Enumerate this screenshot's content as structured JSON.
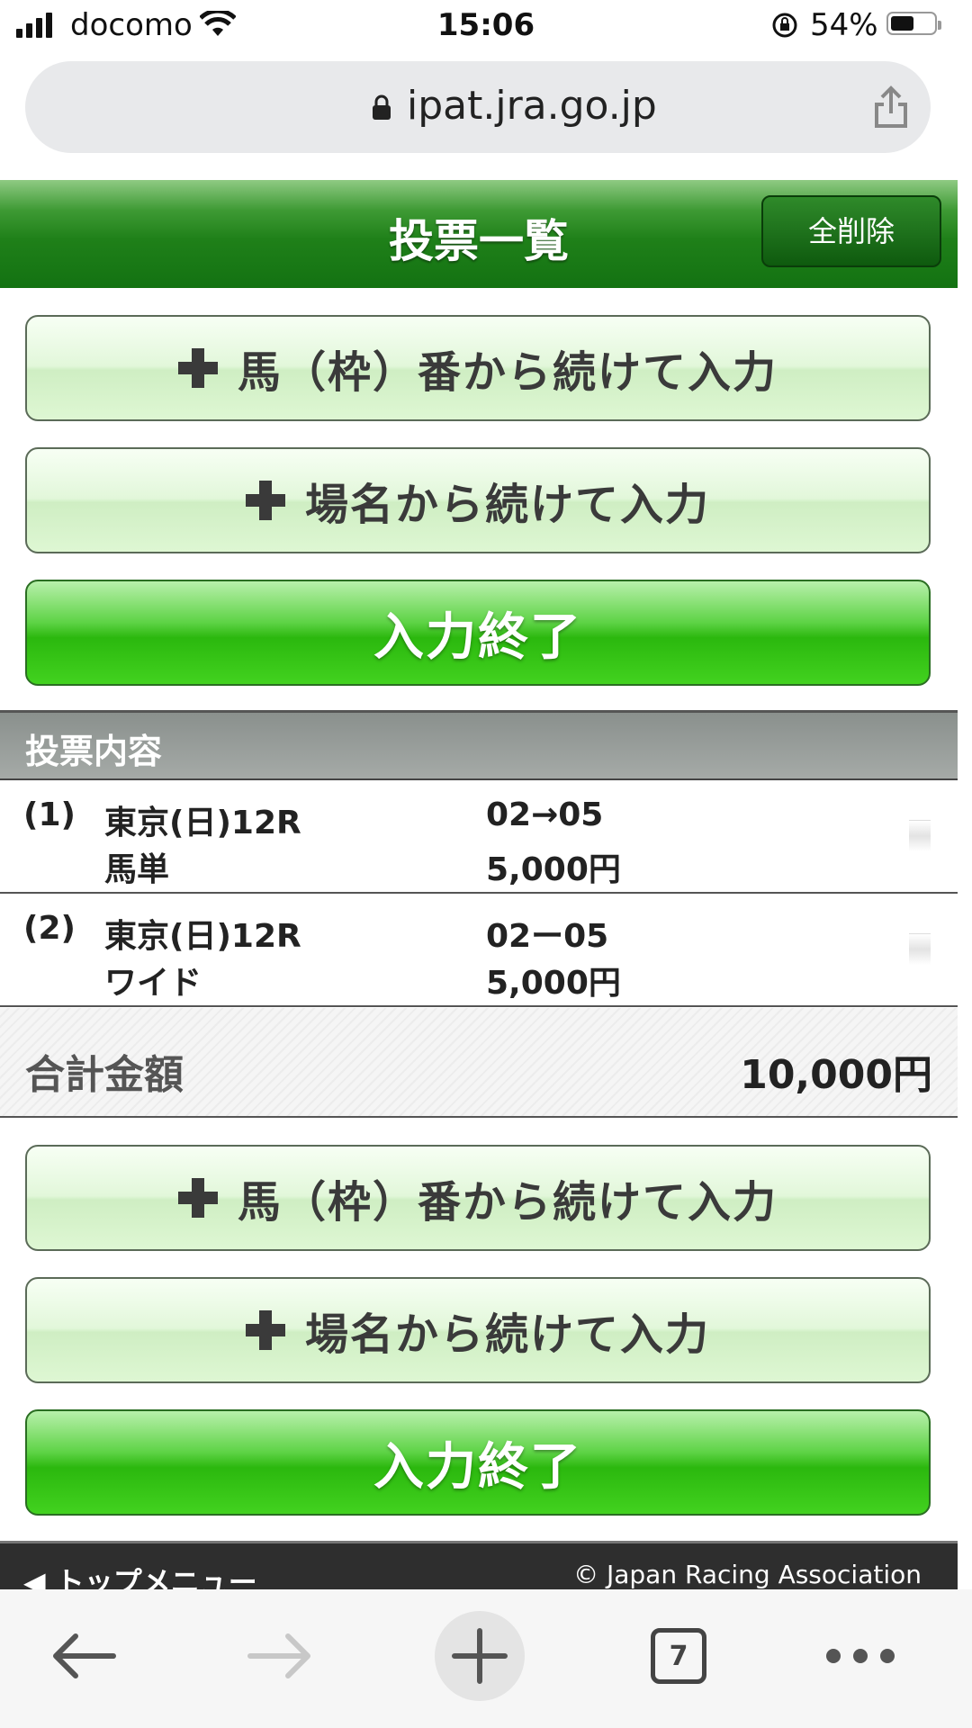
{
  "status_bar": {
    "carrier": "docomo",
    "time": "15:06",
    "battery": "54%",
    "battery_level": 0.54
  },
  "browser": {
    "url": "ipat.jra.go.jp",
    "tab_count": "7"
  },
  "header": {
    "title": "投票一覧",
    "delete_all": "全削除"
  },
  "actions_top": {
    "continue_by_number": "馬（枠）番から続けて入力",
    "continue_by_venue": "場名から続けて入力",
    "finish": "入力終了"
  },
  "bets": {
    "section_title": "投票内容",
    "items": [
      {
        "index": "(1)",
        "race": "東京(日)12R",
        "type": "馬単",
        "combo": "02→05",
        "amount": "5,000円"
      },
      {
        "index": "(2)",
        "race": "東京(日)12R",
        "type": "ワイド",
        "combo": "02ー05",
        "amount": "5,000円"
      }
    ],
    "total_label": "合計金額",
    "total_value": "10,000円"
  },
  "actions_bottom": {
    "continue_by_number": "馬（枠）番から続けて入力",
    "continue_by_venue": "場名から続けて入力",
    "finish": "入力終了"
  },
  "footer": {
    "left": "◀ トップメニュー",
    "right": "© Japan Racing Association"
  }
}
